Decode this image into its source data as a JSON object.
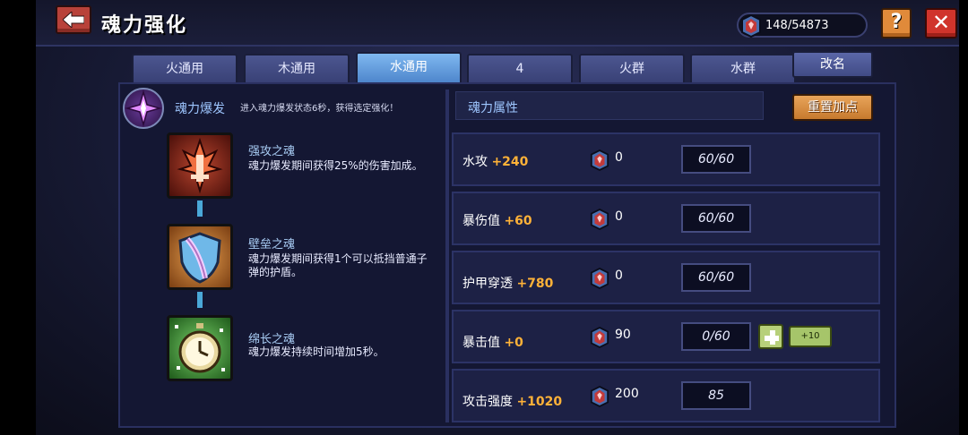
{
  "header": {
    "title": "魂力强化",
    "currency": "148/54873",
    "help_label": "?",
    "close_label": "✕"
  },
  "tabs": [
    {
      "label": "火通用",
      "active": false
    },
    {
      "label": "木通用",
      "active": false
    },
    {
      "label": "水通用",
      "active": true
    },
    {
      "label": "4",
      "active": false
    },
    {
      "label": "火群",
      "active": false
    },
    {
      "label": "水群",
      "active": false
    }
  ],
  "rename_label": "改名",
  "burst": {
    "title": "魂力爆发",
    "desc": "进入魂力爆发状态6秒，获得选定强化！"
  },
  "skills": [
    {
      "name": "强攻之魂",
      "desc": "魂力爆发期间获得25%的伤害加成。",
      "icon": "flame-sword-icon"
    },
    {
      "name": "壁垒之魂",
      "desc": "魂力爆发期间获得1个可以抵挡普通子弹的护盾。",
      "icon": "shield-icon"
    },
    {
      "name": "绵长之魂",
      "desc": "魂力爆发持续时间增加5秒。",
      "icon": "stopwatch-icon"
    }
  ],
  "attributes": {
    "title": "魂力属性",
    "reset_label": "重置加点",
    "rows": [
      {
        "label": "水攻",
        "bonus": "+240",
        "cost": "0",
        "value": "60/60"
      },
      {
        "label": "暴伤值",
        "bonus": "+60",
        "cost": "0",
        "value": "60/60"
      },
      {
        "label": "护甲穿透",
        "bonus": "+780",
        "cost": "0",
        "value": "60/60"
      },
      {
        "label": "暴击值",
        "bonus": "+0",
        "cost": "90",
        "value": "0/60",
        "increment": "+10"
      },
      {
        "label": "攻击强度",
        "bonus": "+1020",
        "cost": "200",
        "value": "85"
      }
    ]
  },
  "colors": {
    "accent_blue": "#4e86cc",
    "bonus_orange": "#ffb238",
    "close_red": "#d0342c"
  }
}
